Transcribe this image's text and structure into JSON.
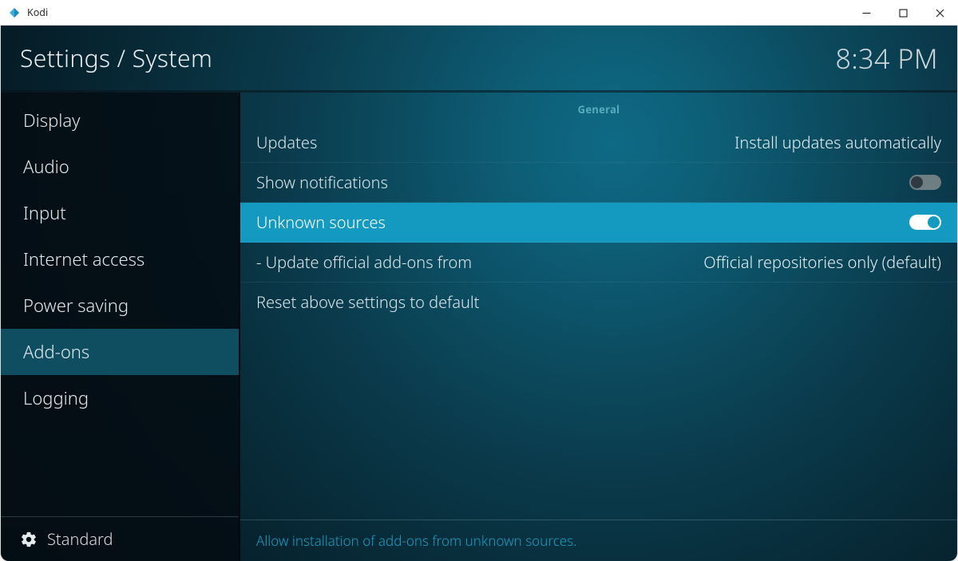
{
  "window": {
    "title": "Kodi"
  },
  "header": {
    "breadcrumb": "Settings / System",
    "clock": "8:34 PM"
  },
  "sidebar": {
    "items": [
      {
        "label": "Display"
      },
      {
        "label": "Audio"
      },
      {
        "label": "Input"
      },
      {
        "label": "Internet access"
      },
      {
        "label": "Power saving"
      },
      {
        "label": "Add-ons",
        "selected": true
      },
      {
        "label": "Logging"
      }
    ],
    "level_label": "Standard"
  },
  "main": {
    "group_header": "General",
    "settings": {
      "updates": {
        "label": "Updates",
        "value": "Install updates automatically"
      },
      "show_notifications": {
        "label": "Show notifications",
        "toggle": false
      },
      "unknown_sources": {
        "label": "Unknown sources",
        "toggle": true,
        "highlighted": true
      },
      "update_official": {
        "label": "- Update official add-ons from",
        "value": "Official repositories only (default)"
      },
      "reset": {
        "label": "Reset above settings to default"
      }
    },
    "description": "Allow installation of add-ons from unknown sources."
  }
}
